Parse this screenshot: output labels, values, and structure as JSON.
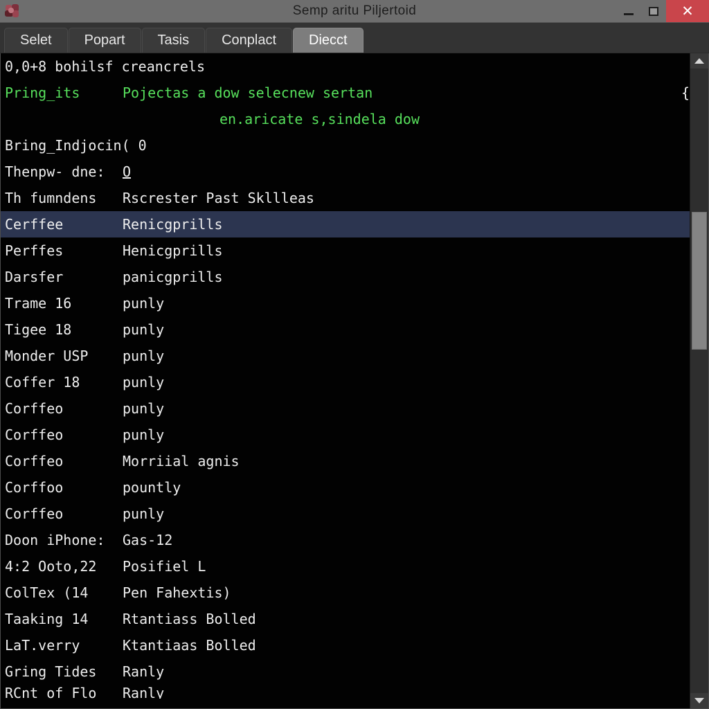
{
  "window": {
    "title": "Semp aritu Piljertoid",
    "icon": "app-icon",
    "controls": {
      "minimize": "–",
      "maximize": "▢",
      "close": "✕"
    }
  },
  "tabs": [
    {
      "label": "Selet",
      "active": false
    },
    {
      "label": "Popart",
      "active": false
    },
    {
      "label": "Tasis",
      "active": false
    },
    {
      "label": "Conplact",
      "active": false
    },
    {
      "label": "Diecct",
      "active": true
    }
  ],
  "listing": {
    "rows": [
      {
        "col1": "0,0+8 bohilsf creancrels",
        "col2": "",
        "style": "single",
        "selected": false
      },
      {
        "col1": "Pring_its",
        "col2": "Pojectas a dow selecnew sertan",
        "brace": "{",
        "style": "green",
        "selected": false
      },
      {
        "col1": "",
        "col2": "en.aricate s,sindela dow",
        "style": "green indent",
        "selected": false
      },
      {
        "col1": "Bring_Indjocin( 0",
        "col2": "",
        "style": "single",
        "selected": false
      },
      {
        "col1": "Thenpw- dne:",
        "col2": "O",
        "style": "underline2",
        "selected": false
      },
      {
        "col1": "Th fumndens",
        "col2": "Rscrester Past Skllleas",
        "style": "",
        "selected": false
      },
      {
        "col1": "Cerffee",
        "col2": "Renicgprills",
        "style": "",
        "selected": true
      },
      {
        "col1": "Perffes",
        "col2": "Henicgprills",
        "style": "",
        "selected": false
      },
      {
        "col1": "Darsfer",
        "col2": "panicgprills",
        "style": "",
        "selected": false
      },
      {
        "col1": "Trame 16",
        "col2": "punly",
        "style": "",
        "selected": false
      },
      {
        "col1": "Tigee 18",
        "col2": "punly",
        "style": "",
        "selected": false
      },
      {
        "col1": "Monder USP",
        "col2": "punly",
        "style": "",
        "selected": false
      },
      {
        "col1": "Coffer 18",
        "col2": "punly",
        "style": "",
        "selected": false
      },
      {
        "col1": "Corffeo",
        "col2": "punly",
        "style": "",
        "selected": false
      },
      {
        "col1": "Corffeo",
        "col2": "punly",
        "style": "",
        "selected": false
      },
      {
        "col1": "Corffeo",
        "col2": "Morriial agnis",
        "style": "",
        "selected": false
      },
      {
        "col1": "Corffoo",
        "col2": "pountly",
        "style": "",
        "selected": false
      },
      {
        "col1": "Corffeo",
        "col2": "punly",
        "style": "",
        "selected": false
      },
      {
        "col1": "Doon iPhone:",
        "col2": "Gas-12",
        "style": "",
        "selected": false
      },
      {
        "col1": "4:2 Ooto,22",
        "col2": "Posifiel L",
        "style": "",
        "selected": false
      },
      {
        "col1": "ColTex (14",
        "col2": "Pen Fahextis)",
        "style": "",
        "selected": false
      },
      {
        "col1": "Taaking 14",
        "col2": "Rtantiass Bolled",
        "style": "",
        "selected": false
      },
      {
        "col1": "LaT.verry",
        "col2": "Ktantiaas Bolled",
        "style": "",
        "selected": false
      },
      {
        "col1": "Gring Tides",
        "col2": "Ranly",
        "style": "",
        "selected": false
      },
      {
        "col1": "RCnt of Flo",
        "col2": "Ranly",
        "style": "clipped",
        "selected": false
      }
    ]
  },
  "scrollbar": {
    "up_arrow": "▲",
    "down_arrow": "▼",
    "thumb_position_pct": 23,
    "thumb_size_pct": 22
  }
}
